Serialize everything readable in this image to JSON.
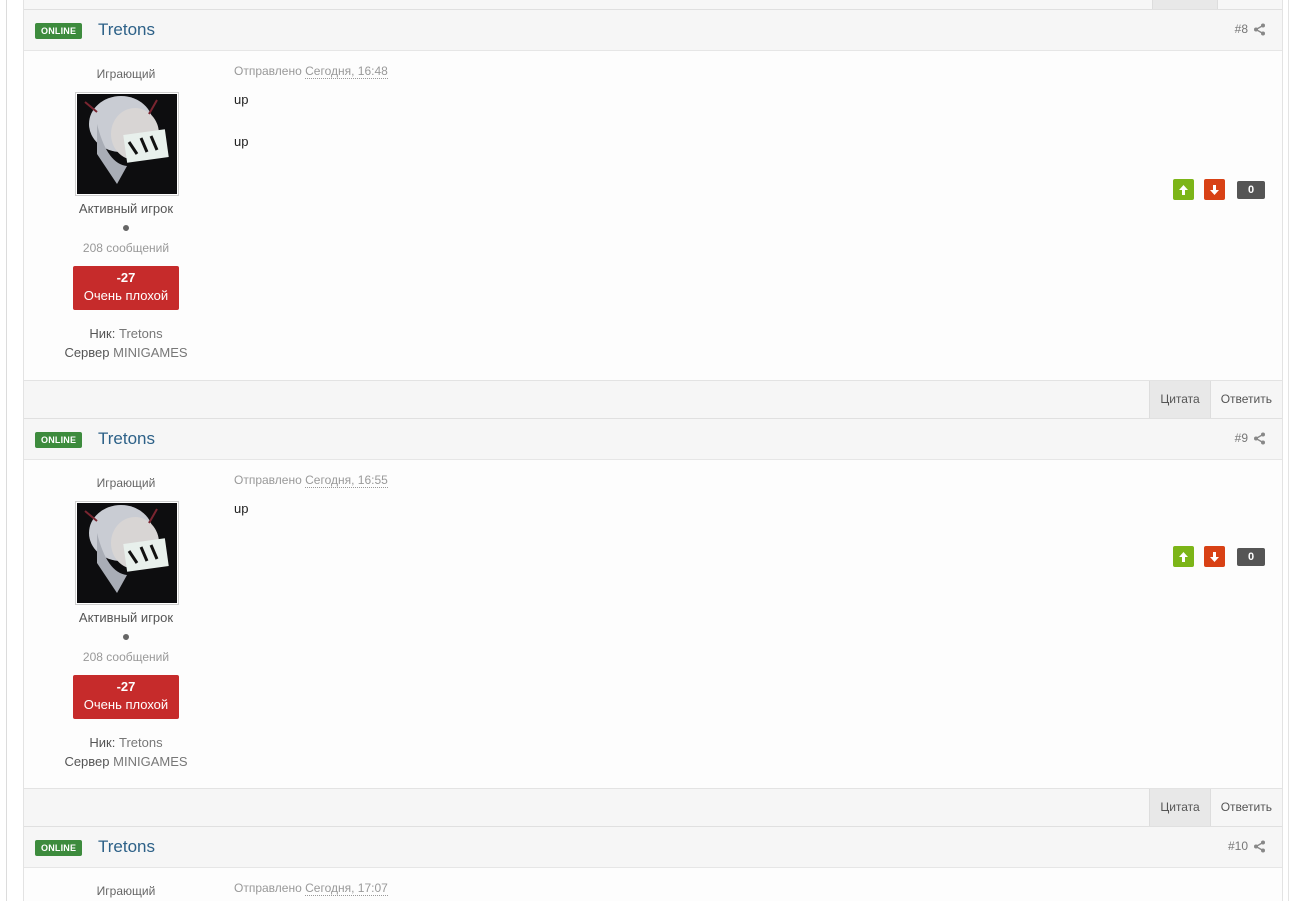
{
  "posts": [
    {
      "status": "ONLINE",
      "author": "Tretons",
      "number": "#8",
      "group": "Играющий",
      "rank": "Активный игрок",
      "post_count": "208 сообщений",
      "reputation": {
        "value": "-27",
        "label": "Очень плохой"
      },
      "nick_label": "Ник:",
      "nick": "Tretons",
      "server_label": "Сервер",
      "server": "MINIGAMES",
      "date_prefix": "Отправлено",
      "date": "Сегодня, 16:48",
      "body": [
        "up",
        "up"
      ],
      "votes": "0",
      "quote_label": "Цитата",
      "reply_label": "Ответить"
    },
    {
      "status": "ONLINE",
      "author": "Tretons",
      "number": "#9",
      "group": "Играющий",
      "rank": "Активный игрок",
      "post_count": "208 сообщений",
      "reputation": {
        "value": "-27",
        "label": "Очень плохой"
      },
      "nick_label": "Ник:",
      "nick": "Tretons",
      "server_label": "Сервер",
      "server": "MINIGAMES",
      "date_prefix": "Отправлено",
      "date": "Сегодня, 16:55",
      "body": [
        "up"
      ],
      "votes": "0",
      "quote_label": "Цитата",
      "reply_label": "Ответить"
    },
    {
      "status": "ONLINE",
      "author": "Tretons",
      "number": "#10",
      "group": "Играющий",
      "date_prefix": "Отправлено",
      "date": "Сегодня, 17:07"
    }
  ],
  "colors": {
    "online_badge": "#3d8b3d",
    "author_link": "#2d6188",
    "reputation_negative": "#c62b2b",
    "vote_up": "#7cb518",
    "vote_down": "#d84115",
    "vote_count": "#555555"
  }
}
